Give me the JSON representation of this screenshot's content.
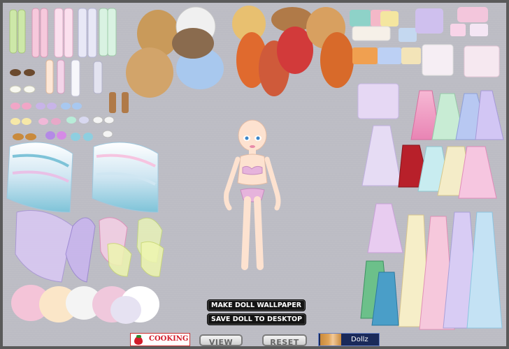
{
  "buttons": {
    "make_wallpaper": "MAKE DOLL WALLPAPER",
    "save_desktop": "SAVE DOLL TO DESKTOP",
    "view": "VIEW",
    "reset": "RESET"
  },
  "ads": {
    "cooking": "COOKING",
    "dollz": "Dollz"
  },
  "colors": {
    "background": "#bcbcc4",
    "frame": "#5a5a5a",
    "skin": "#fde2d0",
    "bikini": "#e6b3dc"
  }
}
